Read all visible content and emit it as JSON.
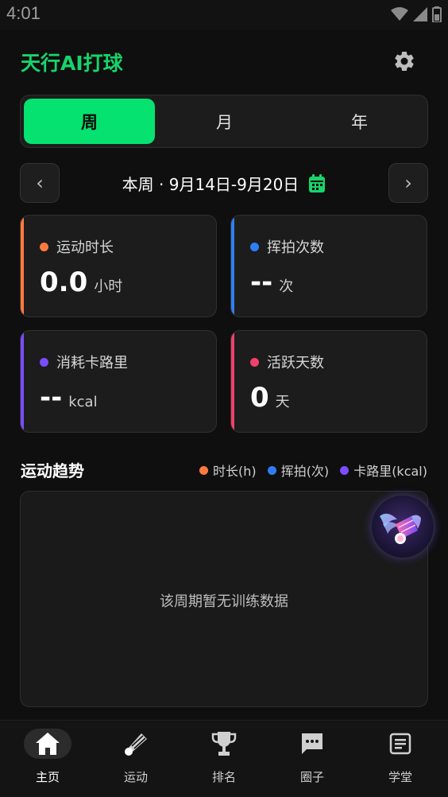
{
  "status_bar": {
    "time": "4:01"
  },
  "header": {
    "title": "天行AI打球"
  },
  "period_tabs": [
    {
      "label": "周",
      "active": true
    },
    {
      "label": "月",
      "active": false
    },
    {
      "label": "年",
      "active": false
    }
  ],
  "date_nav": {
    "prev": "‹",
    "next": "›",
    "range": "本周 · 9月14日-9月20日"
  },
  "stats": [
    {
      "label": "运动时长",
      "value": "0.0",
      "unit": "小时",
      "color": "#ff7a3d"
    },
    {
      "label": "挥拍次数",
      "value": "--",
      "unit": "次",
      "color": "#2f7df6"
    },
    {
      "label": "消耗卡路里",
      "value": "--",
      "unit": "kcal",
      "color": "#7a4dff"
    },
    {
      "label": "活跃天数",
      "value": "0",
      "unit": "天",
      "color": "#f0416b"
    }
  ],
  "trend": {
    "title": "运动趋势",
    "legend": [
      {
        "label": "时长(h)",
        "color": "#ff7a3d"
      },
      {
        "label": "挥拍(次)",
        "color": "#2f7df6"
      },
      {
        "label": "卡路里(kcal)",
        "color": "#7a4dff"
      }
    ],
    "empty_message": "该周期暂无训练数据"
  },
  "bottom_nav": [
    {
      "label": "主页",
      "icon": "home-icon",
      "active": true
    },
    {
      "label": "运动",
      "icon": "shuttlecock-icon",
      "active": false
    },
    {
      "label": "排名",
      "icon": "trophy-icon",
      "active": false
    },
    {
      "label": "圈子",
      "icon": "chat-icon",
      "active": false
    },
    {
      "label": "学堂",
      "icon": "article-icon",
      "active": false
    }
  ],
  "colors": {
    "accent": "#05e26f",
    "title_green": "#18d46a"
  }
}
